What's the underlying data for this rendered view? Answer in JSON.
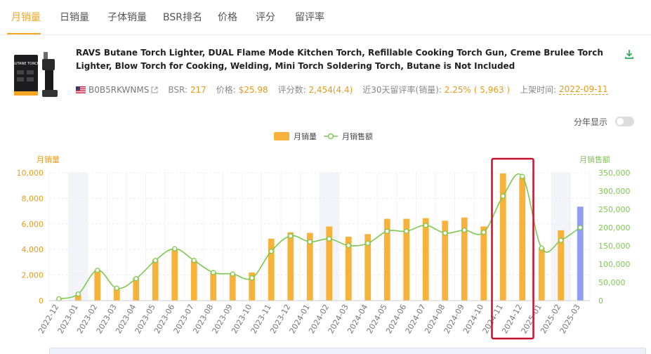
{
  "tabs": [
    {
      "label": "月销量",
      "active": true
    },
    {
      "label": "日销量",
      "active": false
    },
    {
      "label": "子体销量",
      "active": false
    },
    {
      "label": "BSR排名",
      "active": false
    },
    {
      "label": "价格",
      "active": false
    },
    {
      "label": "评分",
      "active": false
    },
    {
      "label": "留评率",
      "active": false
    }
  ],
  "product": {
    "title": "RAVS Butane Torch Lighter, DUAL Flame Mode Kitchen Torch, Refillable Cooking Torch Gun, Creme Brulee Torch Lighter, Blow Torch for Cooking, Welding, Mini Torch Soldering Torch, Butane is Not Included",
    "thumb_text": "BUTANE TORCH",
    "asin": "B0B5RKWNMS",
    "bsr_label": "BSR:",
    "bsr_value": "217",
    "price_label": "价格:",
    "price_value": "$25.98",
    "reviews_label": "评分数:",
    "reviews_value": "2,454(4.4)",
    "review_rate_label": "近30天留评率(销量):",
    "review_rate_value": "2.25% ( 5,963 )",
    "launch_label": "上架时间:",
    "launch_value": "2022-09-11"
  },
  "controls": {
    "year_toggle_label": "分年显示",
    "year_toggle_on": false
  },
  "colors": {
    "accent": "#f5a623",
    "bar": "#f7b23b",
    "bar_highlight": "#8e9ef0",
    "line": "#7ec850",
    "highlight_box": "#c8102e",
    "weekend_band": "#f2f4fa"
  },
  "chart_data": {
    "type": "bar",
    "legend": [
      "月销量",
      "月销售额"
    ],
    "legend_position": "top-center",
    "ylabel_left": "月销量",
    "ylabel_right": "月销售额",
    "ylim_left": [
      0,
      10000
    ],
    "ylim_right": [
      0,
      350000
    ],
    "yticks_left": [
      "0",
      "2,000",
      "4,000",
      "6,000",
      "8,000",
      "10,000"
    ],
    "yticks_right": [
      "0",
      "50,000",
      "100,000",
      "150,000",
      "200,000",
      "250,000",
      "300,000",
      "350,000"
    ],
    "categories": [
      "2022-12",
      "2023-01",
      "2023-02",
      "2023-03",
      "2023-04",
      "2023-05",
      "2023-06",
      "2023-07",
      "2023-08",
      "2023-09",
      "2023-10",
      "2023-11",
      "2023-12",
      "2024-01",
      "2024-02",
      "2024-03",
      "2024-04",
      "2024-05",
      "2024-06",
      "2024-07",
      "2024-08",
      "2024-09",
      "2024-10",
      "2024-11",
      "2024-12",
      "2025-01",
      "2025-02",
      "2025-03"
    ],
    "series": [
      {
        "name": "月销量",
        "type": "bar",
        "values": [
          100,
          450,
          2400,
          950,
          1800,
          3200,
          4050,
          3150,
          2200,
          2100,
          2200,
          4850,
          5350,
          5300,
          5800,
          5000,
          5200,
          6400,
          6400,
          6450,
          6250,
          6500,
          5800,
          9950,
          9650,
          4150,
          5500,
          7350
        ]
      },
      {
        "name": "月销售额",
        "type": "line",
        "values": [
          5000,
          18000,
          83000,
          34000,
          60000,
          110000,
          142000,
          110000,
          77000,
          73000,
          62000,
          135000,
          177000,
          161000,
          169000,
          151000,
          157000,
          190000,
          190000,
          206000,
          185000,
          193000,
          187000,
          286000,
          340000,
          144000,
          165000,
          200000
        ]
      }
    ],
    "highlight_index": 27,
    "shaded_bands": [
      1,
      14,
      26
    ],
    "annotation_box": {
      "from": "2024-11",
      "to": "2024-12"
    },
    "grid": true
  }
}
